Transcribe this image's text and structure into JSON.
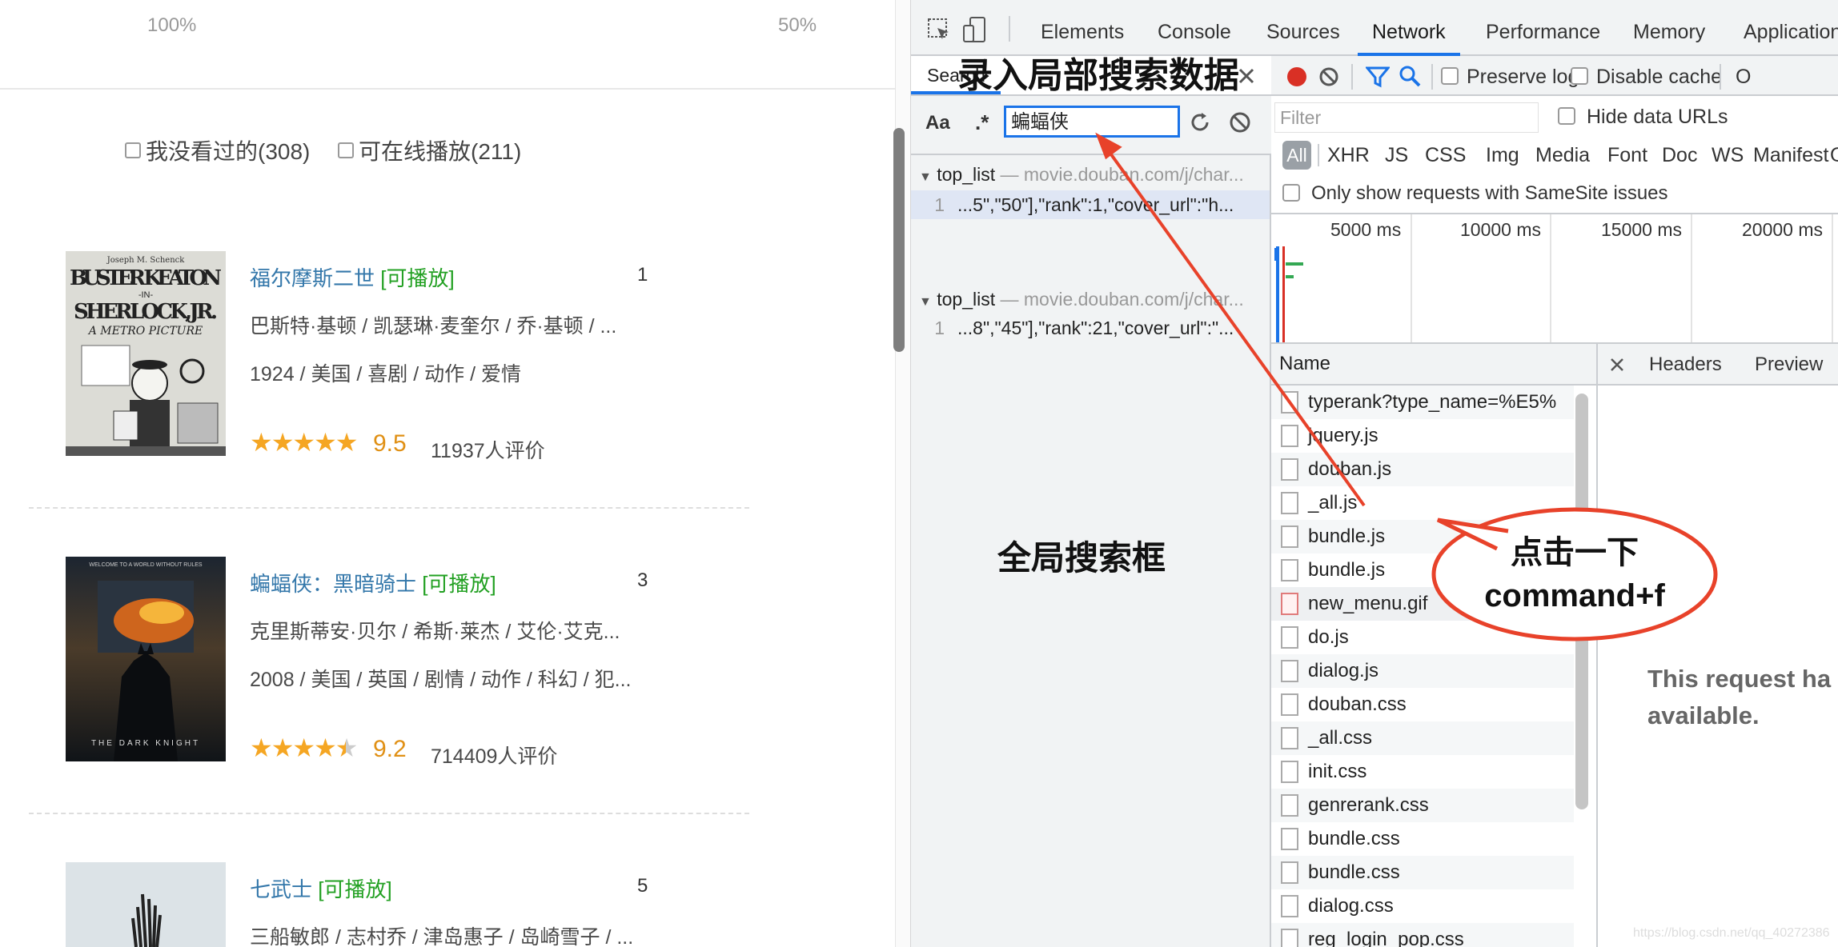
{
  "left": {
    "zoom_a": "100%",
    "zoom_b": "50%",
    "filters": [
      {
        "label": "我没看过的(308)"
      },
      {
        "label": "可在线播放(211)"
      }
    ],
    "movies": [
      {
        "title": "福尔摩斯二世",
        "play": "[可播放]",
        "rank": "1",
        "cast": "巴斯特·基顿 / 凯瑟琳·麦奎尔 / 乔·基顿 / ...",
        "info": "1924 / 美国 / 喜剧 / 动作 / 爱情",
        "stars": "★★★★★",
        "score": "9.5",
        "votes": "11937人评价",
        "rating": 5
      },
      {
        "title": "蝙蝠侠：黑暗骑士",
        "play": "[可播放]",
        "rank": "3",
        "cast": "克里斯蒂安·贝尔 / 希斯·莱杰 / 艾伦·艾克...",
        "info": "2008 / 美国 / 英国 / 剧情 / 动作 / 科幻 / 犯...",
        "stars": "★★★★★",
        "score": "9.2",
        "votes": "714409人评价",
        "rating": 4.5
      },
      {
        "title": "七武士",
        "play": "[可播放]",
        "rank": "5",
        "cast": "三船敏郎 / 志村乔 / 津岛惠子 / 岛崎雪子 / ..."
      }
    ],
    "poster1_text": {
      "top": "Joseph M. Schenck",
      "l1": "BUSTER KEATON",
      "l2": "-IN-",
      "l3": "SHERLOCK,JR.",
      "l4": "A METRO PICTURE"
    },
    "poster2_text": {
      "top": "WELCOME TO A WORLD WITHOUT RULES",
      "bottom": "THE DARK KNIGHT"
    }
  },
  "devtools": {
    "tabs": [
      "Elements",
      "Console",
      "Sources",
      "Network",
      "Performance",
      "Memory",
      "Application"
    ],
    "active_tab": "Network",
    "search": {
      "tab_label": "Search",
      "case_btn": "Aa",
      "regex_btn": ".*",
      "query": "蝙蝠侠",
      "results": [
        {
          "file": "top_list",
          "sep": "—",
          "url": "movie.douban.com/j/char...",
          "line": "1",
          "snippet": "...5\",\"50\"],\"rank\":1,\"cover_url\":\"h..."
        },
        {
          "file": "top_list",
          "sep": "—",
          "url": "movie.douban.com/j/char...",
          "line": "1",
          "snippet": "...8\",\"45\"],\"rank\":21,\"cover_url\":\"..."
        }
      ]
    },
    "network": {
      "preserve_log": "Preserve log",
      "disable_cache": "Disable cache",
      "more": "O",
      "filter_placeholder": "Filter",
      "hide_data_urls": "Hide data URLs",
      "types": [
        "All",
        "XHR",
        "JS",
        "CSS",
        "Img",
        "Media",
        "Font",
        "Doc",
        "WS",
        "Manifest",
        "O"
      ],
      "samesite": "Only show requests with SameSite issues",
      "timeline_labels": [
        "5000 ms",
        "10000 ms",
        "15000 ms",
        "20000 ms"
      ],
      "name_header": "Name",
      "requests": [
        "typerank?type_name=%E5%",
        "jquery.js",
        "douban.js",
        "_all.js",
        "bundle.js",
        "bundle.js",
        "new_menu.gif",
        "do.js",
        "dialog.js",
        "douban.css",
        "_all.css",
        "init.css",
        "genrerank.css",
        "bundle.css",
        "bundle.css",
        "dialog.css",
        "reg_login_pop.css"
      ],
      "detail_tabs": [
        "Headers",
        "Preview"
      ],
      "no_request_line1": "This request ha",
      "no_request_line2": "available."
    }
  },
  "annotations": {
    "top": "录入局部搜索数据",
    "middle": "全局搜索框",
    "bubble_line1": "点击一下",
    "bubble_line2": "command+f",
    "color": "#e8422a"
  },
  "watermark": "https://blog.csdn.net/qq_40272386"
}
